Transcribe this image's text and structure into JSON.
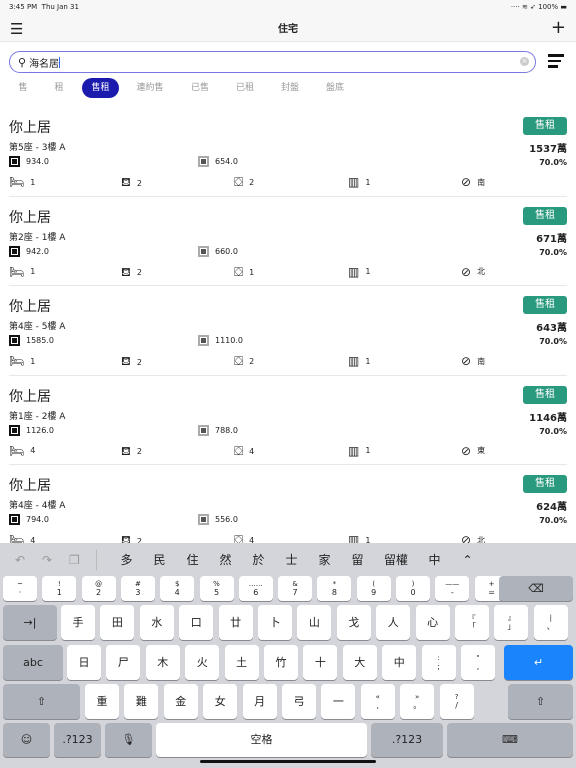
{
  "status": {
    "time": "3:45 PM",
    "date": "Thu Jan 31",
    "battery": "100%"
  },
  "nav": {
    "title": "住宅",
    "menu_icon": "hamburger-icon",
    "add_icon": "plus-icon"
  },
  "search": {
    "value": "海名居"
  },
  "tabs": [
    "售",
    "租",
    "售租",
    "連約售",
    "已售",
    "已租",
    "封盤",
    "盤底"
  ],
  "active_tab": "售租",
  "colors": {
    "accent": "#1b1bad",
    "badge": "#2a9a7f",
    "return_key": "#1a84fc"
  },
  "listings": [
    {
      "title": "你上居",
      "badge": "售租",
      "unit": "第5座 - 3樓 A",
      "price": "1537萬",
      "gross": "934.0",
      "net": "654.0",
      "ratio": "70.0%",
      "bed": "1",
      "living": "2",
      "bath": "2",
      "balcony": "1",
      "facing": "南"
    },
    {
      "title": "你上居",
      "badge": "售租",
      "unit": "第2座 - 1樓 A",
      "price": "671萬",
      "gross": "942.0",
      "net": "660.0",
      "ratio": "70.0%",
      "bed": "1",
      "living": "2",
      "bath": "1",
      "balcony": "1",
      "facing": "北"
    },
    {
      "title": "你上居",
      "badge": "售租",
      "unit": "第4座 - 5樓 A",
      "price": "643萬",
      "gross": "1585.0",
      "net": "1110.0",
      "ratio": "70.0%",
      "bed": "1",
      "living": "2",
      "bath": "2",
      "balcony": "1",
      "facing": "南"
    },
    {
      "title": "你上居",
      "badge": "售租",
      "unit": "第1座 - 2樓 A",
      "price": "1146萬",
      "gross": "1126.0",
      "net": "788.0",
      "ratio": "70.0%",
      "bed": "4",
      "living": "2",
      "bath": "4",
      "balcony": "1",
      "facing": "東"
    },
    {
      "title": "你上居",
      "badge": "售租",
      "unit": "第4座 - 4樓 A",
      "price": "624萬",
      "gross": "794.0",
      "net": "556.0",
      "ratio": "70.0%",
      "bed": "4",
      "living": "2",
      "bath": "4",
      "balcony": "1",
      "facing": "北"
    }
  ],
  "keyboard": {
    "suggestions": [
      "多",
      "民",
      "住",
      "然",
      "於",
      "士",
      "家",
      "留",
      "留權",
      "中"
    ],
    "row1": [
      [
        "~",
        "·"
      ],
      [
        "!",
        "1"
      ],
      [
        "@",
        "2"
      ],
      [
        "#",
        "3"
      ],
      [
        "$",
        "4"
      ],
      [
        "%",
        "5"
      ],
      [
        "……",
        "6"
      ],
      [
        "&",
        "7"
      ],
      [
        "*",
        "8"
      ],
      [
        "(",
        "9"
      ],
      [
        ")",
        "0"
      ],
      [
        "——",
        "-"
      ],
      [
        "+",
        "="
      ]
    ],
    "row2": [
      "手",
      "田",
      "水",
      "口",
      "廿",
      "卜",
      "山",
      "戈",
      "人",
      "心",
      [
        "『",
        "「"
      ],
      [
        "』",
        "」"
      ],
      [
        "|",
        "、"
      ]
    ],
    "row3": [
      "日",
      "尸",
      "木",
      "火",
      "土",
      "竹",
      "十",
      "大",
      "中",
      [
        ":",
        ";"
      ],
      [
        "\"",
        ","
      ]
    ],
    "row4": [
      "重",
      "難",
      "金",
      "女",
      "月",
      "弓",
      "一",
      [
        "«",
        ","
      ],
      [
        "»",
        "。"
      ],
      [
        "?",
        "/"
      ]
    ],
    "abc": "abc",
    "num": ".?123",
    "space": "空格"
  }
}
